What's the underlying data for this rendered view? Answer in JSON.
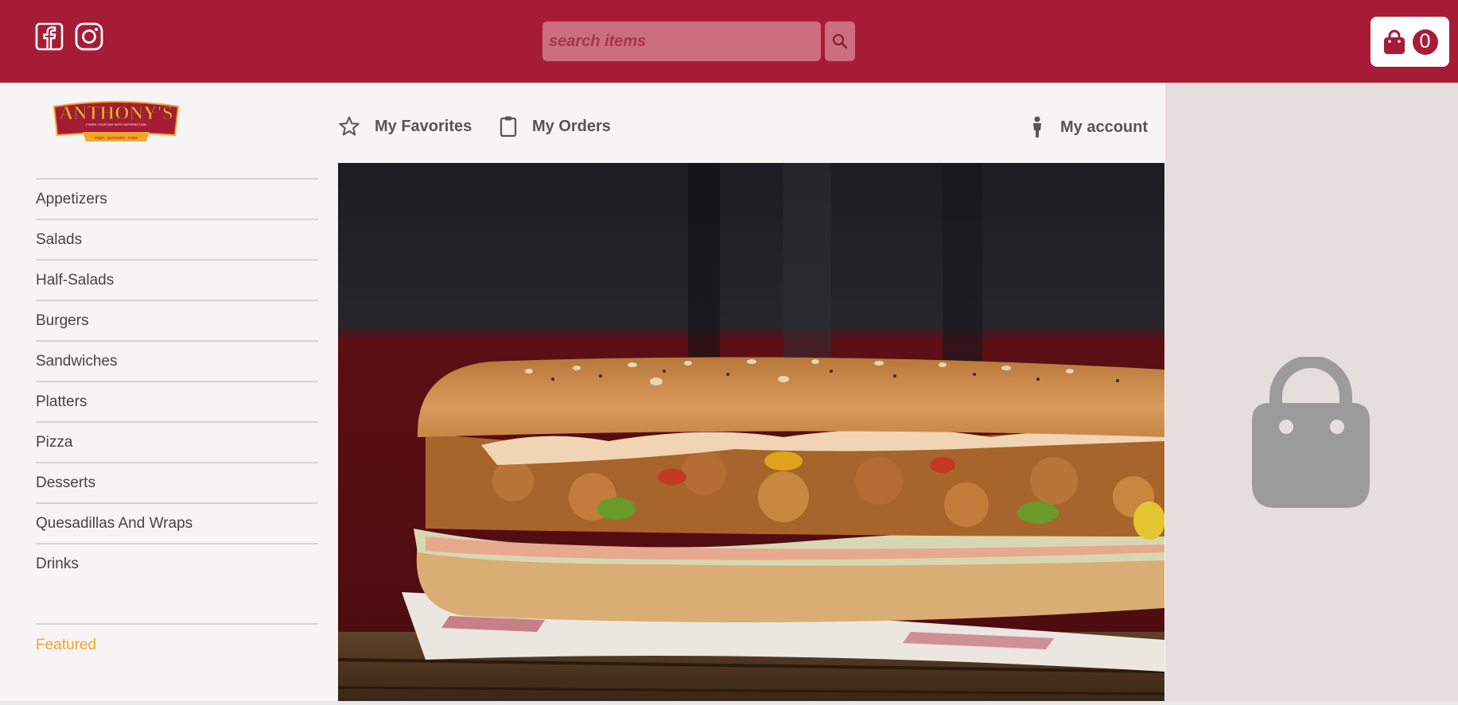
{
  "header": {
    "social": [
      {
        "name": "facebook-icon"
      },
      {
        "name": "instagram-icon"
      }
    ],
    "search": {
      "placeholder": "search items",
      "value": ""
    },
    "cart_count": "0",
    "colors": {
      "brand": "#a61c36",
      "search_bg": "#cc6e7f"
    }
  },
  "brand": {
    "logo_text": "ANTHONY'S",
    "logo_tagline": "FINISH YOUR DAY WITH SATISFACTION",
    "logo_banner": "PIZZA · BURGERS · SUBS"
  },
  "nav": {
    "favorites": "My Favorites",
    "orders": "My Orders",
    "account": "My account"
  },
  "categories": [
    "Appetizers",
    "Salads",
    "Half-Salads",
    "Burgers",
    "Sandwiches",
    "Platters",
    "Pizza",
    "Desserts",
    "Quesadillas And Wraps",
    "Drinks"
  ],
  "featured_label": "Featured",
  "hero": {
    "image": "sub-sandwich-photo"
  },
  "cart_panel": {
    "state": "empty",
    "icon": "shopping-bag-icon",
    "accent": "#f0a72a"
  }
}
